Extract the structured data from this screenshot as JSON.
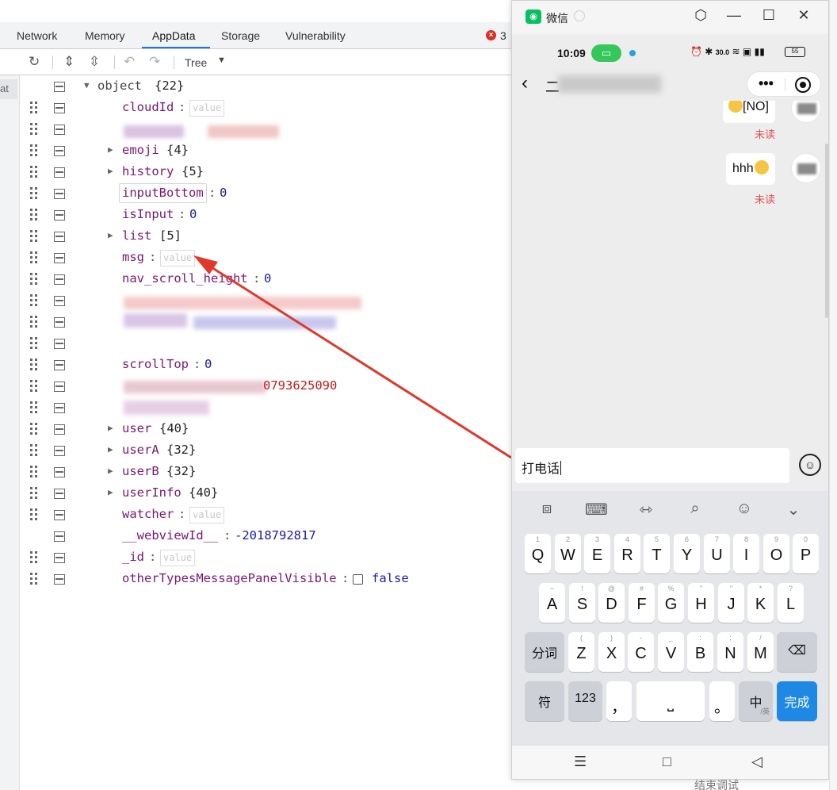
{
  "devtools": {
    "tabs": [
      "Network",
      "Memory",
      "AppData",
      "Storage",
      "Vulnerability"
    ],
    "active_tab": "AppData",
    "error_count": "3",
    "toolbar": {
      "view_mode": "Tree"
    },
    "side_label": "at"
  },
  "tree": {
    "root_key": "object",
    "root_count": "{22}",
    "rows": [
      {
        "key": "cloudId",
        "placeholder": "value"
      },
      {
        "key": "emoji",
        "count": "{4}"
      },
      {
        "key": "history",
        "count": "{5}"
      },
      {
        "key": "inputBottom",
        "value": "0"
      },
      {
        "key": "isInput",
        "value": "0"
      },
      {
        "key": "list",
        "count": "[5]"
      },
      {
        "key": "msg",
        "placeholder": "value"
      },
      {
        "key": "nav_scroll_height",
        "value": "0"
      },
      {
        "key": "scrollTop",
        "value": "0"
      },
      {
        "value_partial": "0793625090"
      },
      {
        "key": "user",
        "count": "{40}"
      },
      {
        "key": "userA",
        "count": "{32}"
      },
      {
        "key": "userB",
        "count": "{32}"
      },
      {
        "key": "userInfo",
        "count": "{40}"
      },
      {
        "key": "watcher",
        "placeholder": "value"
      },
      {
        "key": "__webviewId__",
        "value": "-2018792817"
      },
      {
        "key": "_id",
        "placeholder": "value"
      },
      {
        "key": "otherTypesMessagePanelVisible",
        "value": "false"
      }
    ]
  },
  "phone": {
    "window_title": "微信",
    "status": {
      "time": "10:09",
      "speed": "30.0",
      "battery": "55"
    },
    "chat_title_prefix": "二",
    "messages": [
      {
        "text": "[NO]",
        "status": "未读"
      },
      {
        "text": "hhh",
        "status": "未读"
      }
    ],
    "input_text": "打电话",
    "keyboard": {
      "row1": [
        [
          "Q",
          "1"
        ],
        [
          "W",
          "2"
        ],
        [
          "E",
          "3"
        ],
        [
          "R",
          "4"
        ],
        [
          "T",
          "5"
        ],
        [
          "Y",
          "6"
        ],
        [
          "U",
          "7"
        ],
        [
          "I",
          "8"
        ],
        [
          "O",
          "9"
        ],
        [
          "P",
          "0"
        ]
      ],
      "row2": [
        [
          "A",
          "~"
        ],
        [
          "S",
          "!"
        ],
        [
          "D",
          "@"
        ],
        [
          "F",
          "#"
        ],
        [
          "G",
          "%"
        ],
        [
          "H",
          "\""
        ],
        [
          "J",
          "\""
        ],
        [
          "K",
          "*"
        ],
        [
          "L",
          "?"
        ]
      ],
      "row3": [
        [
          "Z",
          "("
        ],
        [
          "X",
          ")"
        ],
        [
          "C",
          "-"
        ],
        [
          "V",
          "_"
        ],
        [
          "B",
          ":"
        ],
        [
          "N",
          ";"
        ],
        [
          "M",
          "/"
        ]
      ],
      "fn_fenci": "分词",
      "fn_fu": "符",
      "fn_123": "123",
      "comma": "，",
      "period": "。",
      "zh": "中",
      "zh_sub": "/英",
      "done": "完成"
    },
    "bottom_cut_text": "结束调试"
  },
  "colors": {
    "accent": "#1a73e8",
    "wechat_green": "#07c160",
    "annotation_red": "#e0392b",
    "done_blue": "#1e88e5"
  }
}
